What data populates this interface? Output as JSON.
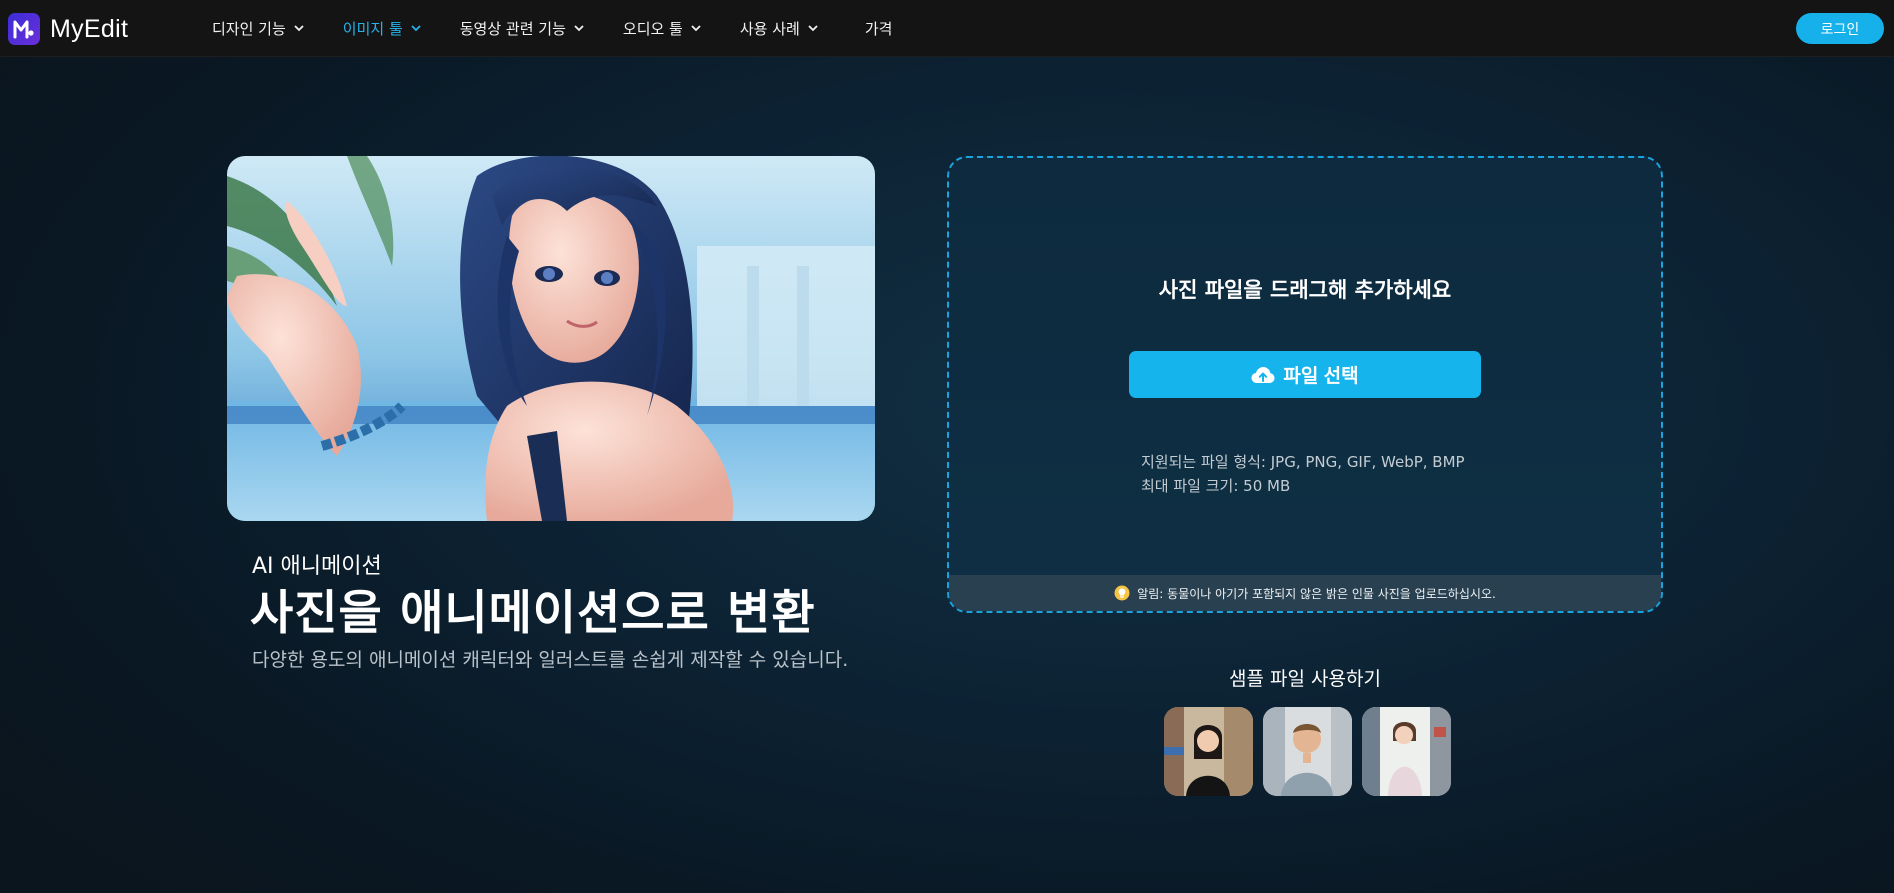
{
  "brand": {
    "name": "MyEdit",
    "logo_icon": "myedit-logo-icon"
  },
  "nav": {
    "items": [
      {
        "label": "디자인 기능",
        "dropdown": true,
        "active": false
      },
      {
        "label": "이미지 툴",
        "dropdown": true,
        "active": true
      },
      {
        "label": "동영상 관련 기능",
        "dropdown": true,
        "active": false
      },
      {
        "label": "오디오 툴",
        "dropdown": true,
        "active": false
      },
      {
        "label": "사용 사례",
        "dropdown": true,
        "active": false
      },
      {
        "label": "가격",
        "dropdown": false,
        "active": false
      }
    ],
    "login_label": "로그인"
  },
  "hero": {
    "subtitle": "AI 애니메이션",
    "title": "사진을 애니메이션으로 변환",
    "description": "다양한 용도의 애니메이션 캐릭터와 일러스트를 손쉽게 제작할 수 있습니다."
  },
  "upload": {
    "drag_text": "사진 파일을 드래그해 추가하세요",
    "button_label": "파일 선택",
    "button_icon": "cloud-upload-icon",
    "formats_line": "지원되는 파일 형식: JPG, PNG, GIF, WebP, BMP",
    "maxsize_line": "최대 파일 크기: 50 MB",
    "notice": "알림: 동물이나 아기가 포함되지 않은 밝은 인물 사진을 업로드하십시오.",
    "notice_icon": "lightbulb-icon"
  },
  "samples": {
    "title": "샘플 파일 사용하기",
    "count": 3
  },
  "colors": {
    "accent": "#16b0ea",
    "active_nav": "#27b2ea",
    "nav_bg": "#141414",
    "upload_border": "#1aa3dc"
  }
}
